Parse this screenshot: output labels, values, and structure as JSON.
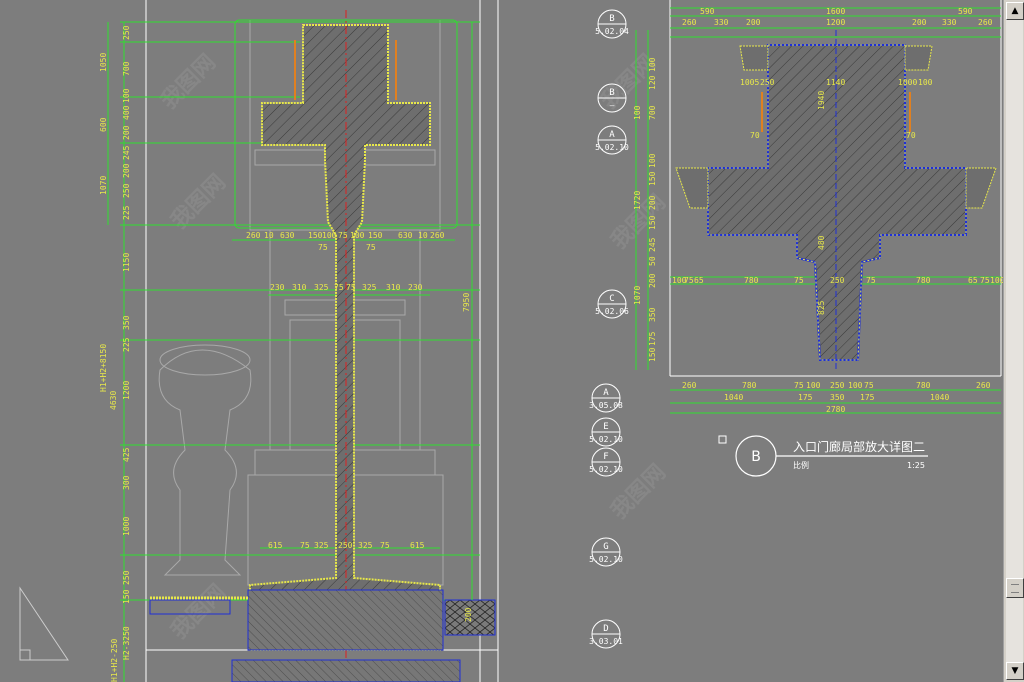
{
  "elevation": {
    "top_dims_h": [
      "260",
      "10",
      "630",
      "150",
      "100",
      "75",
      "100",
      "150",
      "630",
      "10",
      "260"
    ],
    "top_mid_dims": [
      "75",
      "75"
    ],
    "mid_dims_h": [
      "230",
      "310",
      "325",
      "75",
      "75",
      "325",
      "310",
      "230"
    ],
    "base_dims_h": [
      "615",
      "75",
      "325",
      "250",
      "325",
      "75",
      "615"
    ],
    "left_dims_v": [
      "250",
      "700",
      "100",
      "400",
      "200",
      "245",
      "200",
      "250",
      "225",
      "1150",
      "350",
      "225",
      "1200",
      "425",
      "300",
      "1000",
      "250",
      "150",
      "200"
    ],
    "left_group_dims": [
      "1050",
      "600",
      "1070"
    ],
    "total_height_label": "H1+H2+8150",
    "sub_total": "4630",
    "right_total": "7950",
    "bottom_labels": [
      "H2-3250",
      "H1+H2-250"
    ]
  },
  "detail": {
    "title": "入口门廊局部放大详图二",
    "bubble": "B",
    "subtitle": "比例",
    "scale": "1:25",
    "top_dims": [
      "590",
      "1600",
      "590"
    ],
    "top_dims2": [
      "260",
      "330",
      "200",
      "1200",
      "200",
      "330",
      "260"
    ],
    "inner_labels": [
      "1005",
      "250",
      "1140",
      "1000",
      "1000",
      "100",
      "70",
      "70"
    ],
    "mid_dims": [
      "100",
      "75",
      "65",
      "780",
      "75",
      "250",
      "75",
      "780",
      "65",
      "75",
      "100"
    ],
    "bottom_dims1": [
      "260",
      "780",
      "75",
      "100",
      "250",
      "100",
      "75",
      "780",
      "260"
    ],
    "bottom_dims2": [
      "1040",
      "175",
      "350",
      "175",
      "1040"
    ],
    "bottom_total": "2780",
    "left_dims_v": [
      "100",
      "120",
      "700",
      "100",
      "100",
      "150",
      "100",
      "600",
      "200",
      "150",
      "245",
      "50",
      "200",
      "1720",
      "1070",
      "350",
      "175",
      "150"
    ],
    "center_v": [
      "1940",
      "480",
      "825"
    ]
  },
  "bubbles": [
    {
      "label": "B",
      "sub": "5.02.04"
    },
    {
      "label": "B",
      "sub": "—"
    },
    {
      "label": "A",
      "sub": "5.02.10"
    },
    {
      "label": "C",
      "sub": "5.02.06"
    },
    {
      "label": "A",
      "sub": "3.05.08"
    },
    {
      "label": "E",
      "sub": "5.02.10"
    },
    {
      "label": "F",
      "sub": "5.02.10"
    },
    {
      "label": "G",
      "sub": "5.02.10"
    },
    {
      "label": "D",
      "sub": "3.03.01"
    }
  ],
  "watermark": "我图网",
  "scrollbar": {
    "up": "▲",
    "down": "▼"
  },
  "colors": {
    "bg": "#7d7d7d",
    "dim": "#e8e84a",
    "line": "#2ee02e",
    "hatch": "#5a5a5a",
    "blue": "#1f2fd6",
    "red": "#e02020"
  }
}
